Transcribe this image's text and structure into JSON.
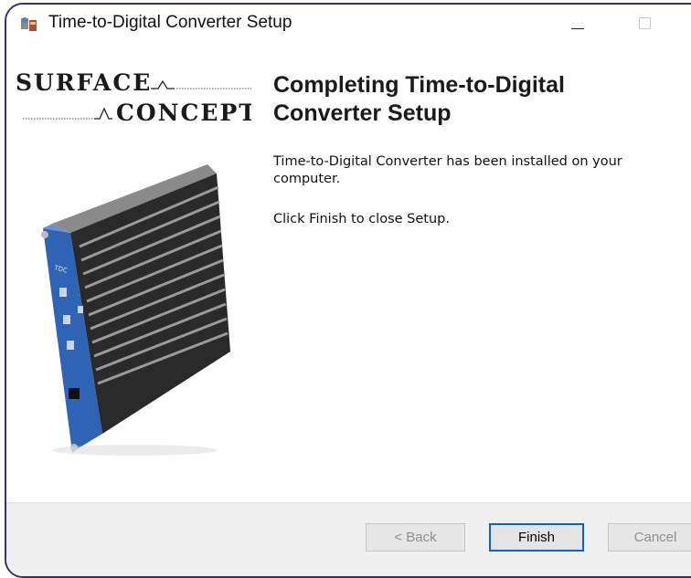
{
  "window": {
    "title": "Time-to-Digital Converter Setup",
    "minimize_glyph": "—",
    "maximize_glyph": "☐"
  },
  "brand": {
    "logo_line1": "SURFACE",
    "logo_line2": "CONCEPT",
    "device_label": "TDC"
  },
  "content": {
    "heading": "Completing Time-to-Digital Converter Setup",
    "paragraph1": "Time-to-Digital Converter has been installed on your computer.",
    "paragraph2": "Click Finish to close Setup."
  },
  "buttons": {
    "back": "< Back",
    "finish": "Finish",
    "cancel": "Cancel"
  },
  "colors": {
    "frame_border": "#3b2d72",
    "accent_button_border": "#0a67c9",
    "device_panel": "#2f63b4"
  }
}
